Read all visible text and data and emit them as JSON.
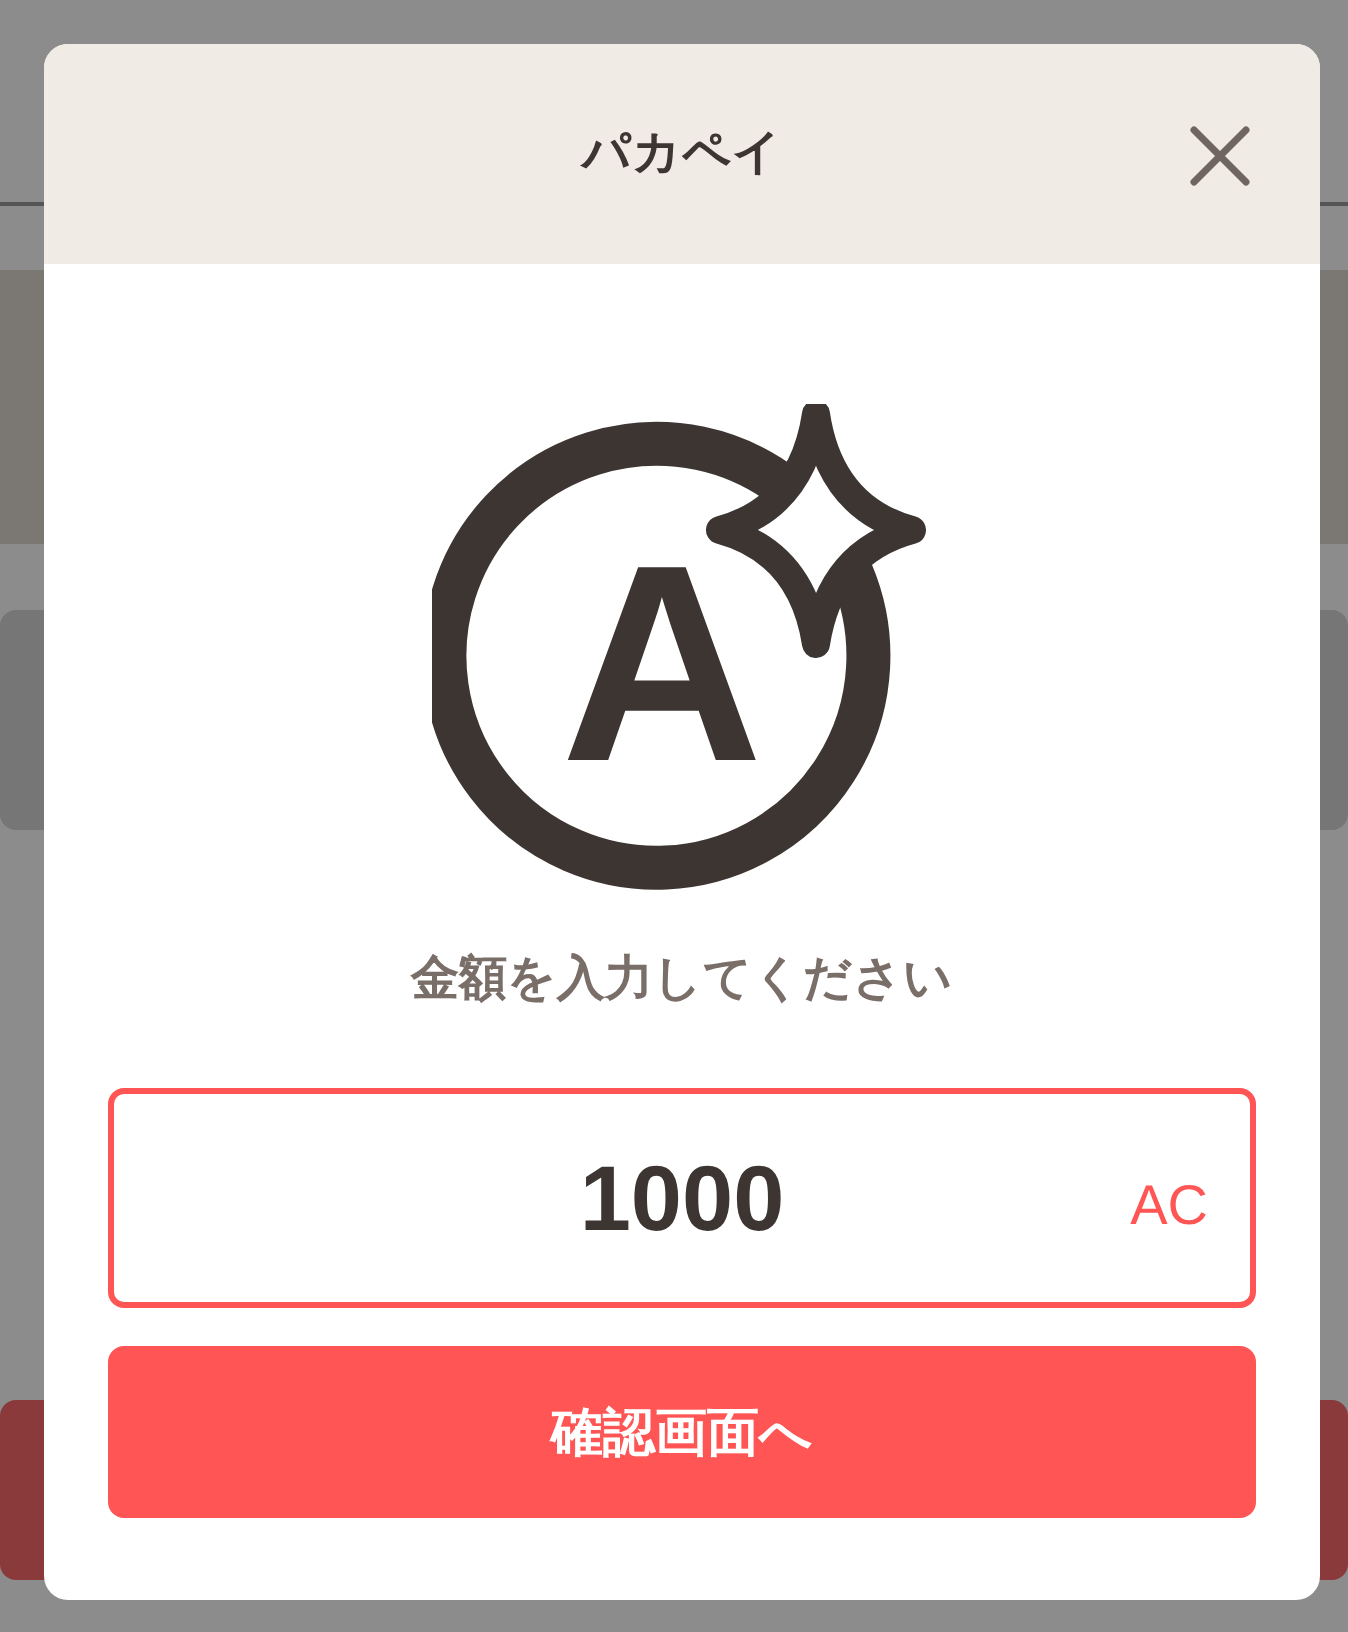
{
  "dialog": {
    "title": "パカペイ",
    "logo_letter": "A",
    "prompt": "金額を入力してください",
    "amount": {
      "value": "1000",
      "unit": "AC"
    },
    "button": "確認画面へ"
  }
}
